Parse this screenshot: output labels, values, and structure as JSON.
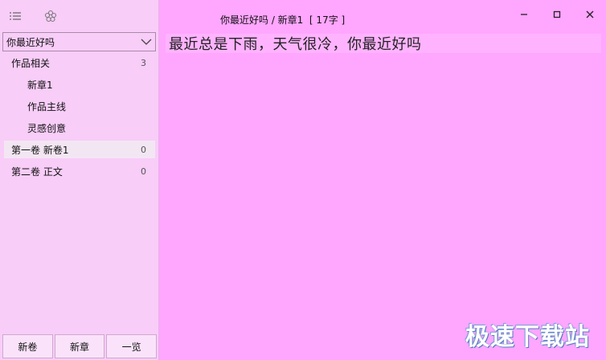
{
  "sidebar": {
    "book_select": {
      "value": "你最近好吗"
    },
    "tree": [
      {
        "type": "group",
        "label": "作品相关",
        "count": "3"
      },
      {
        "type": "child",
        "label": "新章1"
      },
      {
        "type": "child",
        "label": "作品主线"
      },
      {
        "type": "child",
        "label": "灵感创意"
      },
      {
        "type": "group",
        "label": "第一卷 新卷1",
        "count": "0",
        "selected": true
      },
      {
        "type": "group",
        "label": "第二卷 正文",
        "count": "0"
      }
    ],
    "buttons": {
      "new_volume": "新卷",
      "new_chapter": "新章",
      "overview": "一览"
    }
  },
  "editor": {
    "title": "你最近好吗 / 新章1  [ 17字 ]",
    "text": "最近总是下雨，天气很冷，你最近好吗"
  },
  "watermark": "极速下载站",
  "icons": {
    "menu": "menu-icon",
    "settings": "flower-settings-icon",
    "dropdown": "chevron-down-icon",
    "minimize": "minimize-icon",
    "maximize": "maximize-icon",
    "close": "close-icon"
  },
  "colors": {
    "editor_background": "#ffa6ff",
    "sidebar_background": "#f8cdf8",
    "selected_row": "#f3e6f3"
  }
}
